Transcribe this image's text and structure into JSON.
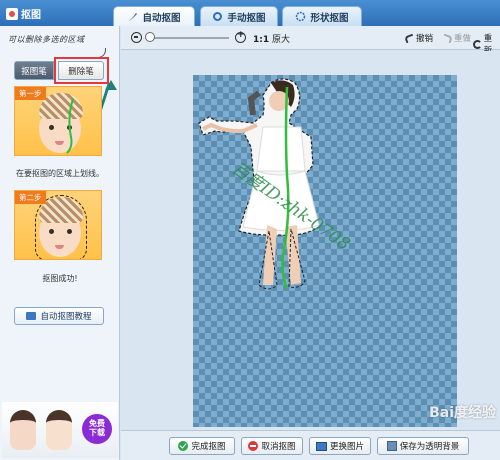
{
  "app": {
    "title": "抠图"
  },
  "tabs": [
    {
      "label": "自动抠图",
      "active": true
    },
    {
      "label": "手动抠图",
      "active": false
    },
    {
      "label": "形状抠图",
      "active": false
    }
  ],
  "left_panel": {
    "hint": "可以删除多选的区域",
    "mode_buttons": [
      {
        "label": "抠图笔",
        "active": true
      },
      {
        "label": "删除笔",
        "active": false
      }
    ],
    "steps": [
      {
        "tag": "第一步",
        "caption": "在要抠图的区域上划线。"
      },
      {
        "tag": "第二步",
        "caption": "抠图成功!"
      }
    ],
    "tutorial_button": "自动抠图教程",
    "promo": {
      "badge_line1": "免费",
      "badge_line2": "下载"
    }
  },
  "toolbar": {
    "ratio": "1:1",
    "ratio_label": "原大",
    "undo": "撤销",
    "redo": "重做",
    "reset": "重新"
  },
  "canvas": {
    "overlay_text": "百度ID:zhk-0708"
  },
  "bottom_buttons": [
    {
      "label": "完成抠图",
      "icon": "check-icon"
    },
    {
      "label": "取消抠图",
      "icon": "cancel-icon"
    },
    {
      "label": "更换图片",
      "icon": "image-icon"
    },
    {
      "label": "保存为透明背景",
      "icon": "save-icon"
    }
  ],
  "watermark": "Bai度经验",
  "colors": {
    "title_bar": "#2d6fb8",
    "highlight_box": "#e23a3a",
    "arrow": "#1f7f7a",
    "stroke_line": "#2fbf3a",
    "overlay_text": "#2a8c4a"
  }
}
